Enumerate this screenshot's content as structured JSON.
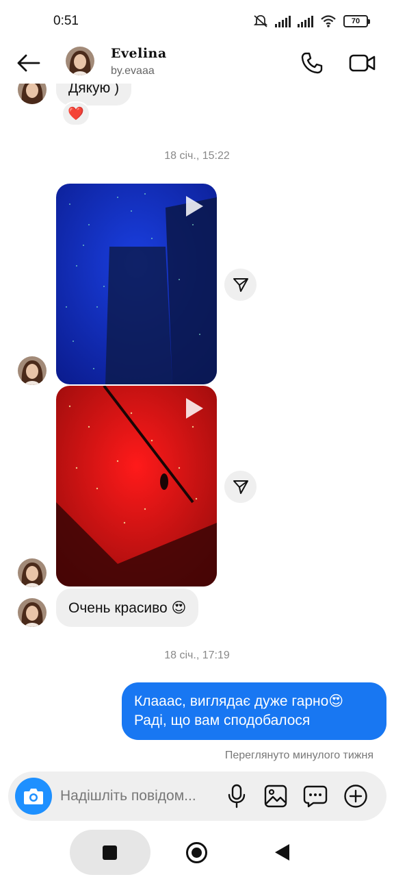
{
  "status_bar": {
    "time": "0:51",
    "battery": "70"
  },
  "header": {
    "name": "Evelina",
    "handle": "by.evaaa"
  },
  "messages": {
    "first_bubble_text": "Дякую )",
    "first_reaction": "❤️",
    "timestamp_1": "18 січ., 15:22",
    "reply_text": "Очень красиво 😍",
    "timestamp_2": "18 січ., 17:19",
    "outgoing_line_1": "Клааас, виглядає дуже гарно😍",
    "outgoing_line_2": "Раді, що вам сподобалося",
    "seen_text": "Переглянуто минулого тижня"
  },
  "composer": {
    "placeholder": "Надішліть повідом..."
  },
  "colors": {
    "accent": "#1877f2",
    "camera": "#1e90ff",
    "bubble_in": "#efefef"
  },
  "icons": [
    "back-arrow-icon",
    "phone-icon",
    "video-camera-icon",
    "play-icon",
    "send-icon",
    "camera-icon",
    "microphone-icon",
    "gallery-icon",
    "sticker-icon",
    "plus-icon"
  ]
}
